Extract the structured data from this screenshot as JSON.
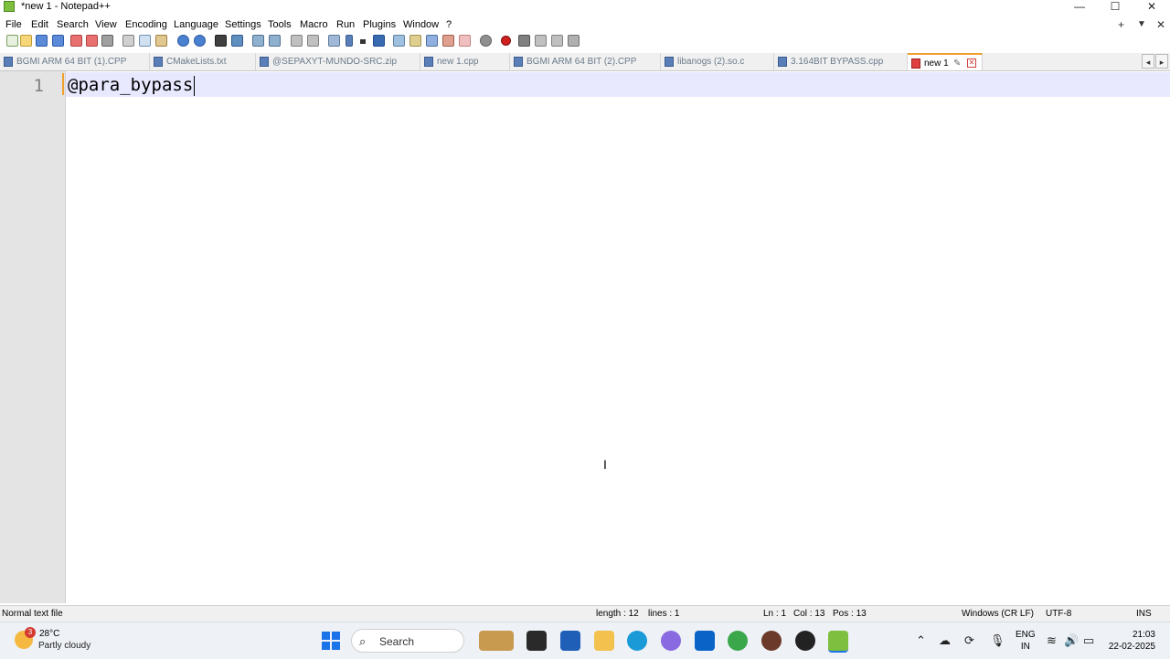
{
  "window": {
    "title": "*new 1 - Notepad++",
    "minimize": "—",
    "maximize": "☐",
    "close": "✕"
  },
  "menu": {
    "items": [
      "File",
      "Edit",
      "Search",
      "View",
      "Encoding",
      "Language",
      "Settings",
      "Tools",
      "Macro",
      "Run",
      "Plugins",
      "Window",
      "?"
    ],
    "right": {
      "add": "+",
      "dropdown": "▼",
      "close": "✕"
    }
  },
  "tabs": [
    {
      "label": "BGMI ARM 64 BIT (1).CPP",
      "active": false
    },
    {
      "label": "CMakeLists.txt",
      "active": false
    },
    {
      "label": "@SEPAXYT-MUNDO-SRC.zip",
      "active": false
    },
    {
      "label": "new 1.cpp",
      "active": false
    },
    {
      "label": "BGMI ARM 64 BIT (2).CPP",
      "active": false
    },
    {
      "label": "libanogs (2).so.c",
      "active": false
    },
    {
      "label": "3.164BIT BYPASS.cpp",
      "active": false
    },
    {
      "label": "new 1",
      "active": true
    }
  ],
  "tab_nav": {
    "left": "◂",
    "right": "▸"
  },
  "editor": {
    "line_number": "1",
    "content": "@para_bypass"
  },
  "status": {
    "file_type": "Normal text file",
    "length": "length : 12",
    "lines": "lines : 1",
    "ln": "Ln : 1",
    "col": "Col : 13",
    "pos": "Pos : 13",
    "eol": "Windows (CR LF)",
    "encoding": "UTF-8",
    "mode": "INS"
  },
  "taskbar": {
    "weather_badge": "3",
    "weather_temp": "28°C",
    "weather_desc": "Partly cloudy",
    "search_label": "Search",
    "lang_top": "ENG",
    "lang_bottom": "IN",
    "time": "21:03",
    "date": "22-02-2025"
  },
  "colors": {
    "accent_tab": "#f0a030",
    "current_line": "#e8e8ff",
    "gutter": "#e4e4e4"
  }
}
